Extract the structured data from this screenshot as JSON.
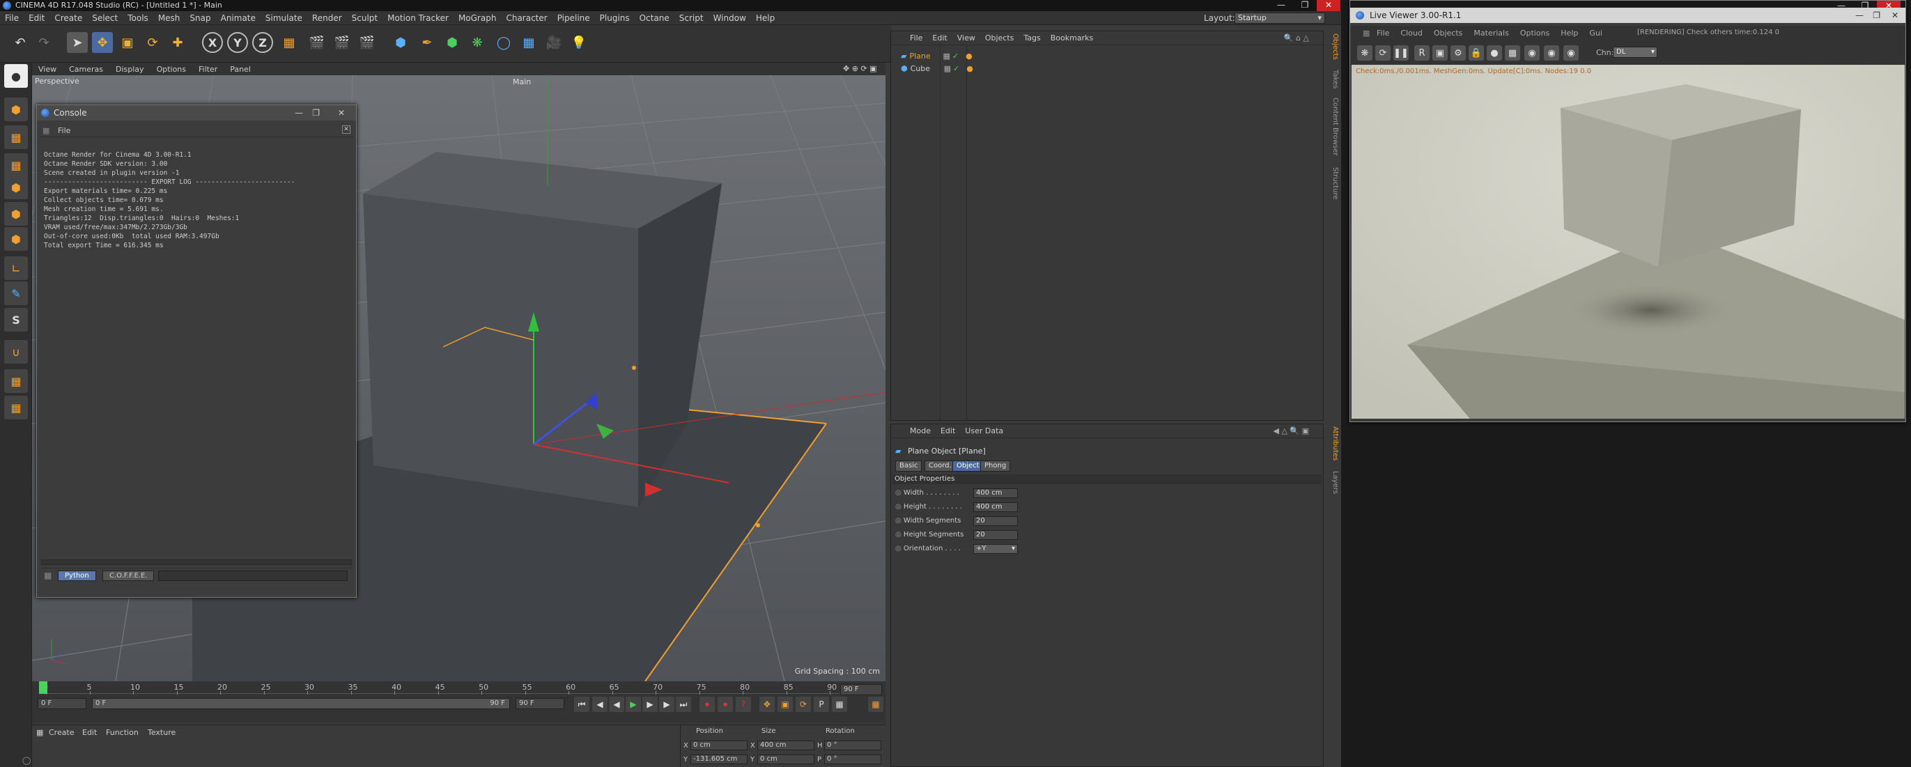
{
  "c4d": {
    "title": "CINEMA 4D R17.048 Studio (RC) - [Untitled 1 *] - Main",
    "menu": [
      "File",
      "Edit",
      "Create",
      "Select",
      "Tools",
      "Mesh",
      "Snap",
      "Animate",
      "Simulate",
      "Render",
      "Sculpt",
      "Motion Tracker",
      "MoGraph",
      "Character",
      "Pipeline",
      "Plugins",
      "Octane",
      "Script",
      "Window",
      "Help"
    ],
    "layout_label": "Layout:",
    "layout_value": "Startup"
  },
  "viewport": {
    "menu": [
      "View",
      "Cameras",
      "Display",
      "Options",
      "Filter",
      "Panel"
    ],
    "label": "Perspective",
    "camera": "Main",
    "grid_spacing": "Grid Spacing : 100 cm"
  },
  "console": {
    "title": "Console",
    "file_menu": "File",
    "lines": [
      "Octane Render for Cinema 4D 3.00-R1.1",
      "Octane Render SDK version: 3.00",
      "Scene created in plugin version -1",
      "-------------------------- EXPORT LOG -------------------------",
      "Export materials time= 0.225 ms",
      "Collect objects time= 0.079 ms",
      "Mesh creation time = 5.691 ms.",
      "Triangles:12  Disp.triangles:0  Hairs:0  Meshes:1",
      "VRAM used/free/max:347Mb/2.273Gb/3Gb",
      "Out-of-core used:0Kb  total used RAM:3.497Gb",
      "Total export Time = 616.345 ms"
    ],
    "tabs": [
      "Python",
      "C.O.F.F.E.E."
    ]
  },
  "timeline": {
    "ticks": [
      "0",
      "5",
      "10",
      "15",
      "20",
      "25",
      "30",
      "35",
      "40",
      "45",
      "50",
      "55",
      "60",
      "65",
      "70",
      "75",
      "80",
      "85",
      "90"
    ],
    "current_frame": "0 F",
    "start_frame": "0 F",
    "range_start": "0 F",
    "range_end": "90 F",
    "end_frame": "90 F",
    "end_frame2": "90 F"
  },
  "material_manager": {
    "menu": [
      "Create",
      "Edit",
      "Function",
      "Texture"
    ]
  },
  "coords": {
    "headers": [
      "Position",
      "Size",
      "Rotation"
    ],
    "row1": {
      "axis1": "X",
      "pos": "0 cm",
      "axis2": "X",
      "size": "400 cm",
      "axis3": "H",
      "rot": "0 °"
    },
    "row2": {
      "axis1": "Y",
      "pos": "-131.605 cm",
      "axis2": "Y",
      "size": "0 cm",
      "axis3": "P",
      "rot": "0 °"
    }
  },
  "object_manager": {
    "menu": [
      "File",
      "Edit",
      "View",
      "Objects",
      "Tags",
      "Bookmarks"
    ],
    "objects": [
      {
        "name": "Plane",
        "selected": true
      },
      {
        "name": "Cube",
        "selected": false
      }
    ]
  },
  "attribute_manager": {
    "menu": [
      "Mode",
      "Edit",
      "User Data"
    ],
    "object_title": "Plane Object [Plane]",
    "tabs": [
      "Basic",
      "Coord.",
      "Object",
      "Phong"
    ],
    "section": "Object Properties",
    "props": [
      {
        "label": "Width . . . . . . . .",
        "value": "400 cm"
      },
      {
        "label": "Height . . . . . . . .",
        "value": "400 cm"
      },
      {
        "label": "Width Segments",
        "value": "20"
      },
      {
        "label": "Height Segments",
        "value": "20"
      },
      {
        "label": "Orientation . . . .",
        "value": "+Y"
      }
    ]
  },
  "side_tabs": [
    "Objects",
    "Takes",
    "Content Browser",
    "Structure"
  ],
  "attr_side_tabs": [
    "Attributes",
    "Layers"
  ],
  "live_viewer": {
    "title": "Live Viewer 3.00-R1.1",
    "menu": [
      "File",
      "Cloud",
      "Objects",
      "Materials",
      "Options",
      "Help",
      "Gui"
    ],
    "top_status": "[RENDERING] Check others time:0.124  0",
    "channel_label": "Chn:",
    "channel_value": "DL",
    "status": "Check:0ms./0.001ms. MeshGen:0ms. Update[C]:0ms. Nodes:19  0.0"
  }
}
